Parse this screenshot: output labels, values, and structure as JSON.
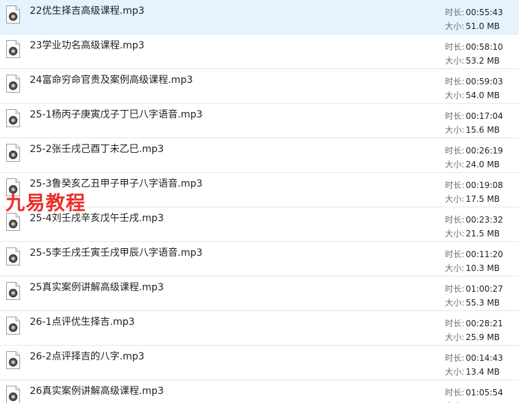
{
  "files": [
    {
      "name": "22优生择吉高级课程.mp3",
      "duration_label": "时长:",
      "duration": "00:55:43",
      "size_label": "大小:",
      "size": "51.0 MB",
      "selected": true
    },
    {
      "name": "23学业功名高级课程.mp3",
      "duration_label": "时长:",
      "duration": "00:58:10",
      "size_label": "大小:",
      "size": "53.2 MB"
    },
    {
      "name": "24富命穷命官贵及案例高级课程.mp3",
      "duration_label": "时长:",
      "duration": "00:59:03",
      "size_label": "大小:",
      "size": "54.0 MB"
    },
    {
      "name": "25-1杨丙子庚寅戊子丁巳八字语音.mp3",
      "duration_label": "时长:",
      "duration": "00:17:04",
      "size_label": "大小:",
      "size": "15.6 MB"
    },
    {
      "name": "25-2张壬戌己酉丁未乙巳.mp3",
      "duration_label": "时长:",
      "duration": "00:26:19",
      "size_label": "大小:",
      "size": "24.0 MB"
    },
    {
      "name": "25-3鲁癸亥乙丑甲子甲子八字语音.mp3",
      "duration_label": "时长:",
      "duration": "00:19:08",
      "size_label": "大小:",
      "size": "17.5 MB"
    },
    {
      "name": "25-4刘壬戌辛亥戊午壬戌.mp3",
      "duration_label": "时长:",
      "duration": "00:23:32",
      "size_label": "大小:",
      "size": "21.5 MB"
    },
    {
      "name": "25-5李壬戌壬寅壬戌甲辰八字语音.mp3",
      "duration_label": "时长:",
      "duration": "00:11:20",
      "size_label": "大小:",
      "size": "10.3 MB"
    },
    {
      "name": "25真实案例讲解高级课程.mp3",
      "duration_label": "时长:",
      "duration": "01:00:27",
      "size_label": "大小:",
      "size": "55.3 MB"
    },
    {
      "name": "26-1点评优生择吉.mp3",
      "duration_label": "时长:",
      "duration": "00:28:21",
      "size_label": "大小:",
      "size": "25.9 MB"
    },
    {
      "name": "26-2点评择吉的八字.mp3",
      "duration_label": "时长:",
      "duration": "00:14:43",
      "size_label": "大小:",
      "size": "13.4 MB"
    },
    {
      "name": "26真实案例讲解高级课程.mp3",
      "duration_label": "时长:",
      "duration": "01:05:54",
      "size_label": "大小:",
      "size": ""
    }
  ],
  "watermark": "九易教程",
  "icon": "audio-file-icon",
  "colors": {
    "selected_bg": "#e5f3ff",
    "watermark": "#e8302b",
    "separator": "#e6e6e6"
  }
}
